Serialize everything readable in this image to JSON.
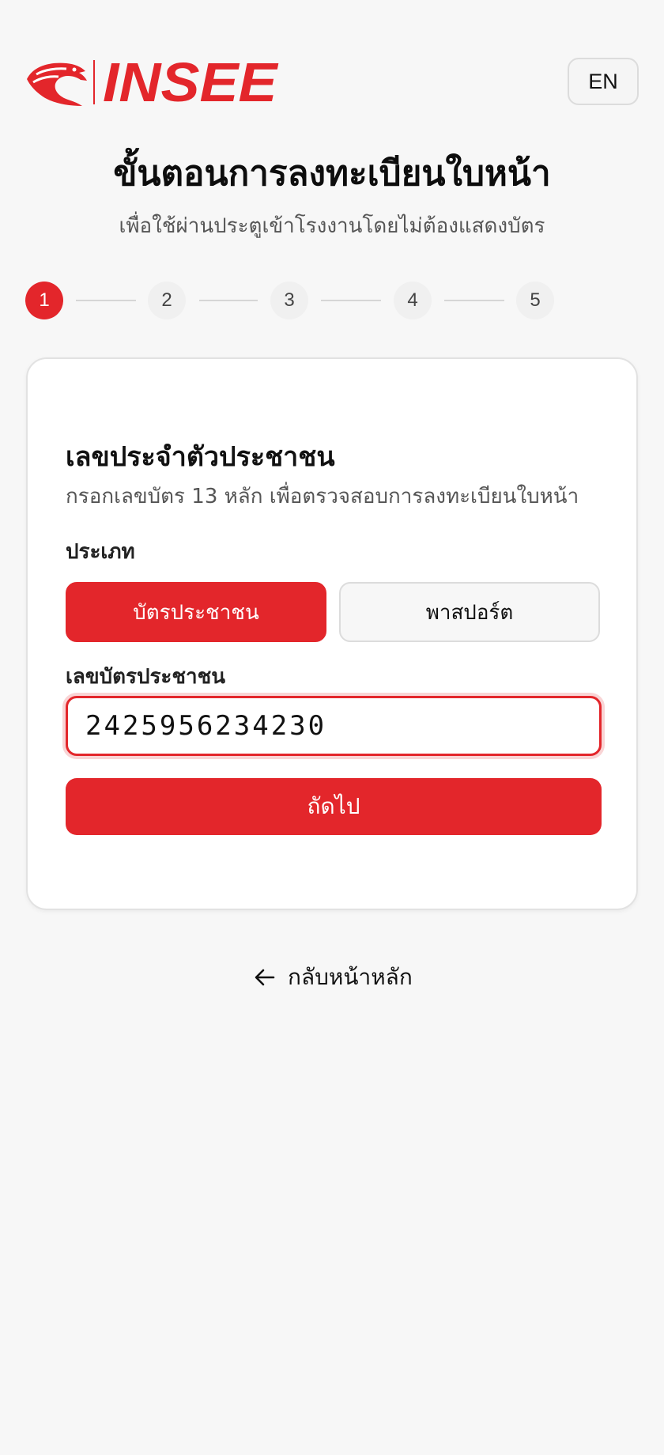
{
  "header": {
    "brand": "INSEE",
    "brand_color": "#e3262b",
    "logo_icon": "eagle-icon",
    "language_button": "EN"
  },
  "page": {
    "title": "ขั้นตอนการลงทะเบียนใบหน้า",
    "subtitle": "เพื่อใช้ผ่านประตูเข้าโรงงานโดยไม่ต้องแสดงบัตร"
  },
  "steps": {
    "items": [
      "1",
      "2",
      "3",
      "4",
      "5"
    ],
    "current": 1
  },
  "form": {
    "title": "เลขประจำตัวประชาชน",
    "description": "กรอกเลขบัตร 13 หลัก เพื่อตรวจสอบการลงทะเบียนใบหน้า",
    "type_label": "ประเภท",
    "type_options": [
      "บัตรประชาชน",
      "พาสปอร์ต"
    ],
    "selected_type": "บัตรประชาชน",
    "id_label": "เลขบัตรประชาชน",
    "id_value": "2425956234230",
    "next_button": "ถัดไป"
  },
  "footer": {
    "back_label": "กลับหน้าหลัก",
    "back_icon": "arrow-left-icon"
  }
}
